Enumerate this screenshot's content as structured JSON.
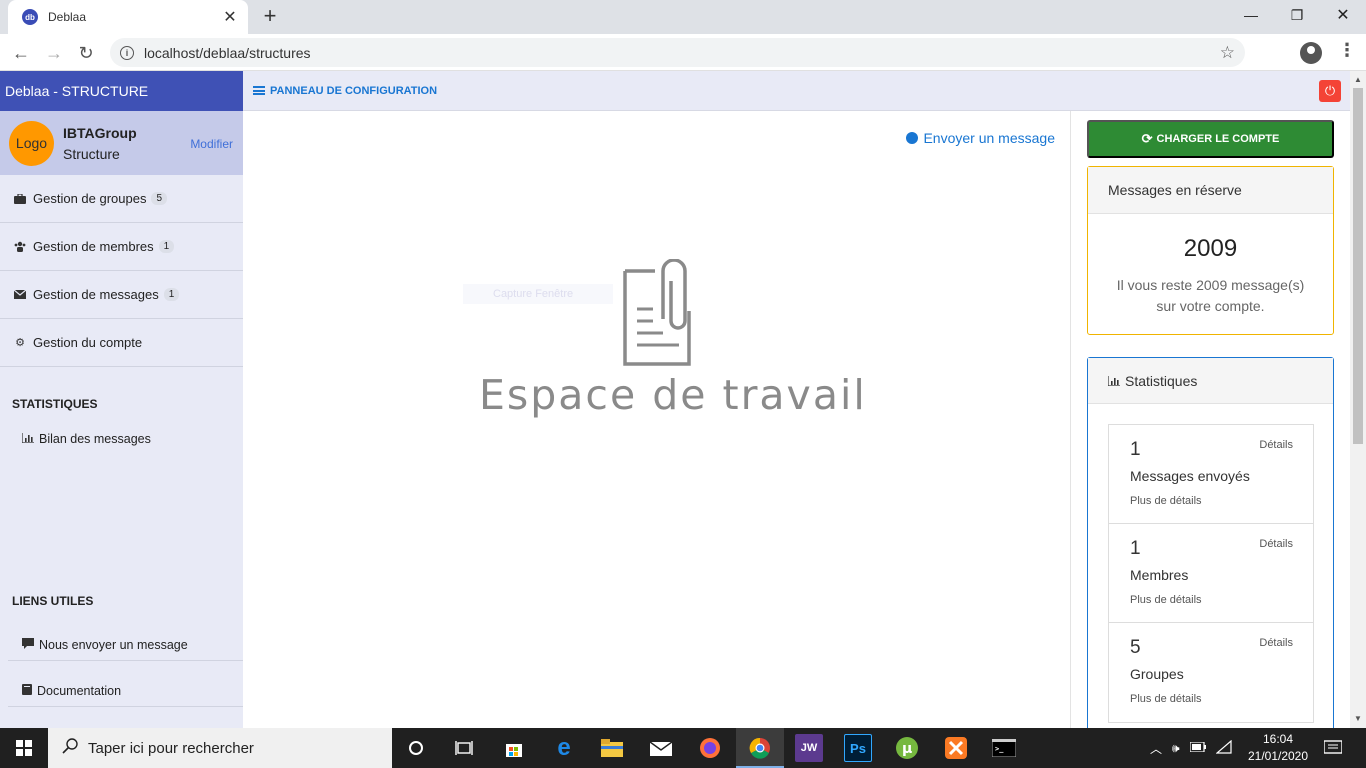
{
  "browser": {
    "tab_title": "Deblaa",
    "favicon_text": "db",
    "url": "localhost/deblaa/structures"
  },
  "sidebar": {
    "brand": "Deblaa - STRUCTURE",
    "logo_text": "Logo",
    "org_name": "IBTAGroup",
    "org_type": "Structure",
    "modify_label": "Modifier",
    "nav": [
      {
        "label": "Gestion de groupes",
        "badge": "5"
      },
      {
        "label": "Gestion de membres",
        "badge": "1"
      },
      {
        "label": "Gestion de messages",
        "badge": "1"
      },
      {
        "label": "Gestion du compte"
      }
    ],
    "stats_heading": "STATISTIQUES",
    "stats_link": "Bilan des messages",
    "links_heading": "LIENS UTILES",
    "links": [
      {
        "label": "Nous envoyer un message"
      },
      {
        "label": "Documentation"
      }
    ]
  },
  "topbar": {
    "panel_title": "PANNEAU DE CONFIGURATION"
  },
  "main": {
    "send_message": "Envoyer un message",
    "workspace_label": "Espace de travail",
    "faded_text": "Capture Fenêtre"
  },
  "right": {
    "charge_button": "CHARGER LE COMPTE",
    "reserve": {
      "title": "Messages en réserve",
      "count": "2009",
      "text": "Il vous reste 2009 message(s) sur votre compte."
    },
    "stats": {
      "title": "Statistiques",
      "items": [
        {
          "value": "1",
          "label": "Messages envoyés",
          "more": "Plus de détails",
          "detail": "Détails"
        },
        {
          "value": "1",
          "label": "Membres",
          "more": "Plus de détails",
          "detail": "Détails"
        },
        {
          "value": "5",
          "label": "Groupes",
          "more": "Plus de détails",
          "detail": "Détails"
        }
      ]
    }
  },
  "taskbar": {
    "search_placeholder": "Taper ici pour rechercher",
    "time": "16:04",
    "date": "21/01/2020",
    "apps": [
      "cortana-icon",
      "task-view-icon",
      "store-icon",
      "edge-icon",
      "file-explorer-icon",
      "mail-icon",
      "firefox-icon",
      "chrome-icon",
      "jw-icon",
      "photoshop-icon",
      "utorrent-icon",
      "xampp-icon",
      "terminal-icon"
    ],
    "jw_label": "JW",
    "ps_label": "Ps"
  },
  "colors": {
    "brand": "#3f51b5",
    "sidebar_bg": "#e8eaf6",
    "primary": "#1976d2",
    "success": "#2e8b34",
    "warning": "#f0b400",
    "danger": "#f44336"
  }
}
